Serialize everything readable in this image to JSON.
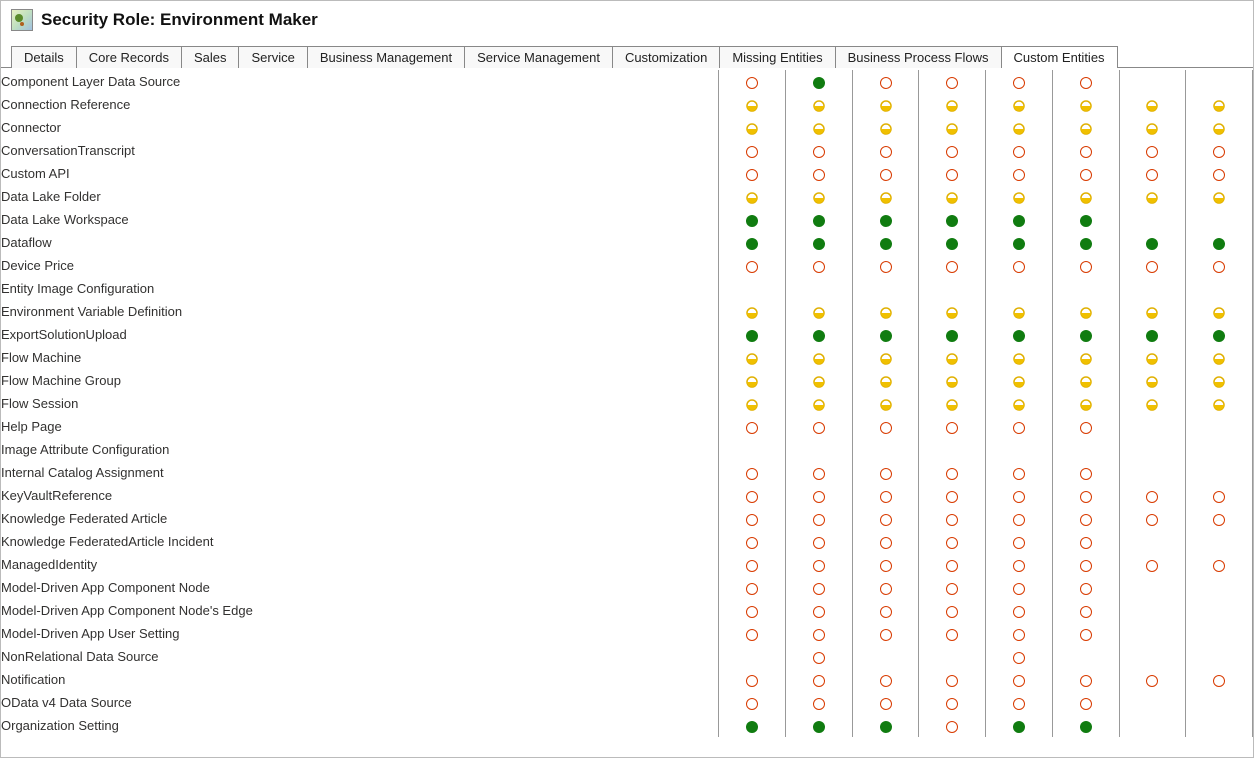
{
  "title": "Security Role: Environment Maker",
  "tabs": [
    "Details",
    "Core Records",
    "Sales",
    "Service",
    "Business Management",
    "Service Management",
    "Customization",
    "Missing Entities",
    "Business Process Flows",
    "Custom Entities"
  ],
  "active_tab_index": 9,
  "legend": {
    "n": "none (empty red circle)",
    "g": "organization (green filled circle)",
    "p": "partial (yellow half-filled circle)",
    "b": "blank (no icon)"
  },
  "entities": [
    {
      "name": "Component Layer Data Source",
      "perms": [
        "n",
        "g",
        "n",
        "n",
        "n",
        "n",
        "b",
        "b"
      ]
    },
    {
      "name": "Connection Reference",
      "perms": [
        "p",
        "p",
        "p",
        "p",
        "p",
        "p",
        "p",
        "p"
      ]
    },
    {
      "name": "Connector",
      "perms": [
        "p",
        "p",
        "p",
        "p",
        "p",
        "p",
        "p",
        "p"
      ]
    },
    {
      "name": "ConversationTranscript",
      "perms": [
        "n",
        "n",
        "n",
        "n",
        "n",
        "n",
        "n",
        "n"
      ]
    },
    {
      "name": "Custom API",
      "perms": [
        "n",
        "n",
        "n",
        "n",
        "n",
        "n",
        "n",
        "n"
      ]
    },
    {
      "name": "Data Lake Folder",
      "perms": [
        "p",
        "p",
        "p",
        "p",
        "p",
        "p",
        "p",
        "p"
      ]
    },
    {
      "name": "Data Lake Workspace",
      "perms": [
        "g",
        "g",
        "g",
        "g",
        "g",
        "g",
        "b",
        "b"
      ]
    },
    {
      "name": "Dataflow",
      "perms": [
        "g",
        "g",
        "g",
        "g",
        "g",
        "g",
        "g",
        "g"
      ]
    },
    {
      "name": "Device Price",
      "perms": [
        "n",
        "n",
        "n",
        "n",
        "n",
        "n",
        "n",
        "n"
      ]
    },
    {
      "name": "Entity Image Configuration",
      "perms": [
        "b",
        "b",
        "b",
        "b",
        "b",
        "b",
        "b",
        "b"
      ]
    },
    {
      "name": "Environment Variable Definition",
      "perms": [
        "p",
        "p",
        "p",
        "p",
        "p",
        "p",
        "p",
        "p"
      ]
    },
    {
      "name": "ExportSolutionUpload",
      "perms": [
        "g",
        "g",
        "g",
        "g",
        "g",
        "g",
        "g",
        "g"
      ]
    },
    {
      "name": "Flow Machine",
      "perms": [
        "p",
        "p",
        "p",
        "p",
        "p",
        "p",
        "p",
        "p"
      ]
    },
    {
      "name": "Flow Machine Group",
      "perms": [
        "p",
        "p",
        "p",
        "p",
        "p",
        "p",
        "p",
        "p"
      ]
    },
    {
      "name": "Flow Session",
      "perms": [
        "p",
        "p",
        "p",
        "p",
        "p",
        "p",
        "p",
        "p"
      ]
    },
    {
      "name": "Help Page",
      "perms": [
        "n",
        "n",
        "n",
        "n",
        "n",
        "n",
        "b",
        "b"
      ]
    },
    {
      "name": "Image Attribute Configuration",
      "perms": [
        "b",
        "b",
        "b",
        "b",
        "b",
        "b",
        "b",
        "b"
      ]
    },
    {
      "name": "Internal Catalog Assignment",
      "perms": [
        "n",
        "n",
        "n",
        "n",
        "n",
        "n",
        "b",
        "b"
      ]
    },
    {
      "name": "KeyVaultReference",
      "perms": [
        "n",
        "n",
        "n",
        "n",
        "n",
        "n",
        "n",
        "n"
      ]
    },
    {
      "name": "Knowledge Federated Article",
      "perms": [
        "n",
        "n",
        "n",
        "n",
        "n",
        "n",
        "n",
        "n"
      ]
    },
    {
      "name": "Knowledge FederatedArticle Incident",
      "perms": [
        "n",
        "n",
        "n",
        "n",
        "n",
        "n",
        "b",
        "b"
      ]
    },
    {
      "name": "ManagedIdentity",
      "perms": [
        "n",
        "n",
        "n",
        "n",
        "n",
        "n",
        "n",
        "n"
      ]
    },
    {
      "name": "Model-Driven App Component Node",
      "perms": [
        "n",
        "n",
        "n",
        "n",
        "n",
        "n",
        "b",
        "b"
      ]
    },
    {
      "name": "Model-Driven App Component Node's Edge",
      "perms": [
        "n",
        "n",
        "n",
        "n",
        "n",
        "n",
        "b",
        "b"
      ]
    },
    {
      "name": "Model-Driven App User Setting",
      "perms": [
        "n",
        "n",
        "n",
        "n",
        "n",
        "n",
        "b",
        "b"
      ]
    },
    {
      "name": "NonRelational Data Source",
      "perms": [
        "b",
        "n",
        "b",
        "b",
        "n",
        "b",
        "b",
        "b"
      ]
    },
    {
      "name": "Notification",
      "perms": [
        "n",
        "n",
        "n",
        "n",
        "n",
        "n",
        "n",
        "n"
      ]
    },
    {
      "name": "OData v4 Data Source",
      "perms": [
        "n",
        "n",
        "n",
        "n",
        "n",
        "n",
        "b",
        "b"
      ]
    },
    {
      "name": "Organization Setting",
      "perms": [
        "g",
        "g",
        "g",
        "n",
        "g",
        "g",
        "b",
        "b"
      ]
    }
  ]
}
